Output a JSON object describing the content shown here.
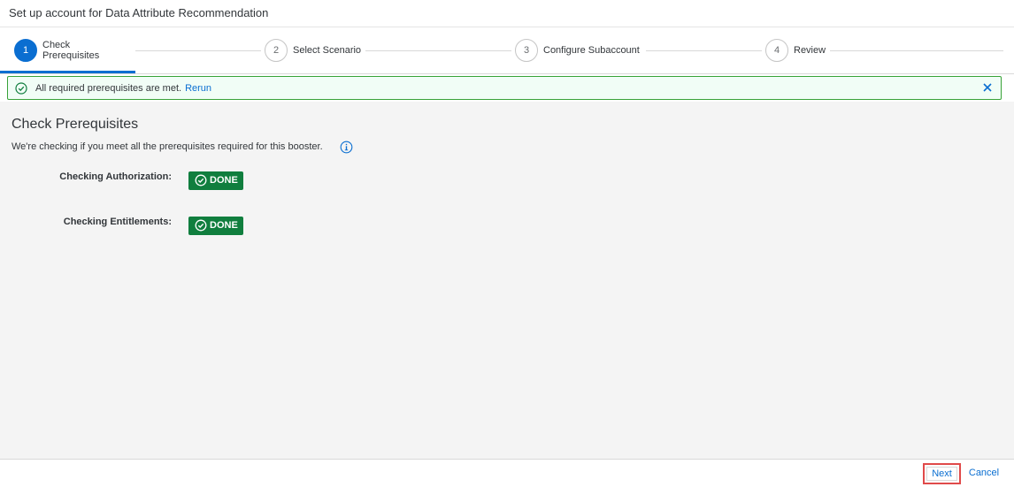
{
  "window": {
    "title": "Set up account for Data Attribute Recommendation"
  },
  "wizard": {
    "steps": [
      {
        "number": "1",
        "label": "Check Prerequisites"
      },
      {
        "number": "2",
        "label": "Select Scenario"
      },
      {
        "number": "3",
        "label": "Configure Subaccount"
      },
      {
        "number": "4",
        "label": "Review"
      }
    ],
    "active_step": 1
  },
  "message_strip": {
    "text": "All required prerequisites are met.",
    "link": "Rerun",
    "type": "success",
    "color": "#38a238"
  },
  "main": {
    "heading": "Check Prerequisites",
    "description": "We're checking if you meet all the prerequisites required for this booster.",
    "checks": [
      {
        "label": "Checking Authorization:",
        "status": "DONE"
      },
      {
        "label": "Checking Entitlements:",
        "status": "DONE"
      }
    ]
  },
  "footer": {
    "next_label": "Next",
    "cancel_label": "Cancel"
  },
  "colors": {
    "accent": "#0a6ed1",
    "success": "#107e3e",
    "highlight": "#e04a4a"
  }
}
